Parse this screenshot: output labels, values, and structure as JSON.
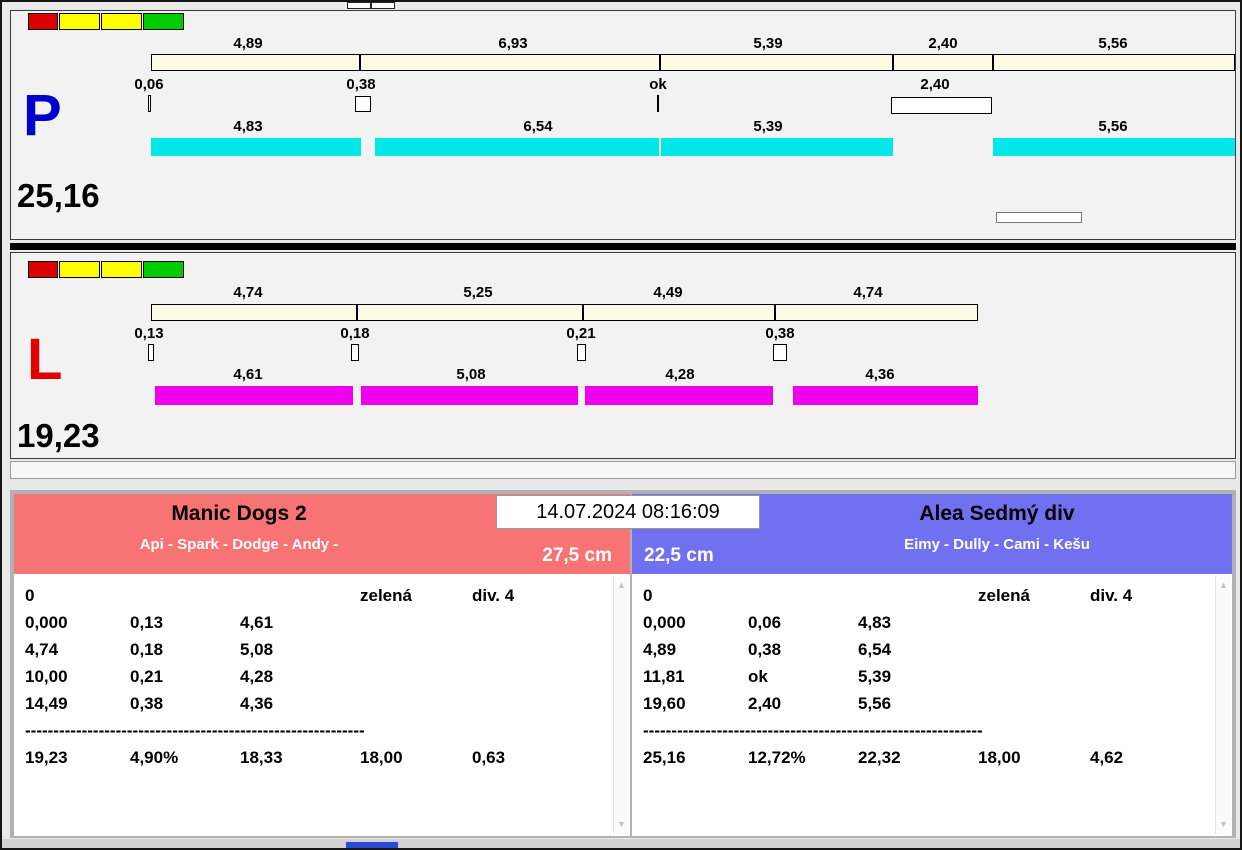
{
  "window": {
    "timestamp": "14.07.2024 08:16:09"
  },
  "track_p": {
    "lane_label": "P",
    "total_time": "25,16",
    "split_times": [
      "4,89",
      "6,93",
      "5,39",
      "2,40",
      "5,56"
    ],
    "changeover_times": [
      "0,06",
      "0,38",
      "ok",
      "2,40"
    ],
    "dog_times": [
      "4,83",
      "6,54",
      "5,39",
      "5,56"
    ]
  },
  "track_l": {
    "lane_label": "L",
    "total_time": "19,23",
    "split_times": [
      "4,74",
      "5,25",
      "4,49",
      "4,74"
    ],
    "changeover_times": [
      "0,13",
      "0,18",
      "0,21",
      "0,38"
    ],
    "dog_times": [
      "4,61",
      "5,08",
      "4,28",
      "4,36"
    ]
  },
  "left_team": {
    "name": "Manic Dogs 2",
    "dogs": "Api - Spark - Dodge - Andy -",
    "jump_height": "27,5 cm",
    "info_row": {
      "penalty": "0",
      "color": "zelená",
      "division": "div. 4"
    },
    "rows": [
      [
        "0,000",
        "0,13",
        "4,61"
      ],
      [
        "4,74",
        "0,18",
        "5,08"
      ],
      [
        "10,00",
        "0,21",
        "4,28"
      ],
      [
        "14,49",
        "0,38",
        "4,36"
      ]
    ],
    "separator": "------------------------------------------------------------",
    "totals": [
      "19,23",
      "4,90%",
      "18,33",
      "18,00",
      "0,63"
    ]
  },
  "right_team": {
    "name": "Alea Sedmý div",
    "dogs": "Eimy - Dully - Cami - Kešu",
    "jump_height": "22,5 cm",
    "info_row": {
      "penalty": "0",
      "color": "zelená",
      "division": "div. 4"
    },
    "rows": [
      [
        "0,000",
        "0,06",
        "4,83"
      ],
      [
        "4,89",
        "0,38",
        "6,54"
      ],
      [
        "11,81",
        "ok",
        "5,39"
      ],
      [
        "19,60",
        "2,40",
        "5,56"
      ]
    ],
    "separator": "------------------------------------------------------------",
    "totals": [
      "25,16",
      "12,72%",
      "22,32",
      "18,00",
      "4,62"
    ]
  },
  "colors": {
    "cyan_bar": "#00e8e8",
    "magenta_bar": "#ee00ee",
    "cream_bar": "#fbfbe6",
    "red_header": "#f87474",
    "blue_header": "#7070f0",
    "status_red": "#dd0000",
    "status_yellow": "#ffff00",
    "status_green": "#00cc00",
    "lane_p_color": "#0000cc",
    "lane_l_color": "#e00000"
  }
}
